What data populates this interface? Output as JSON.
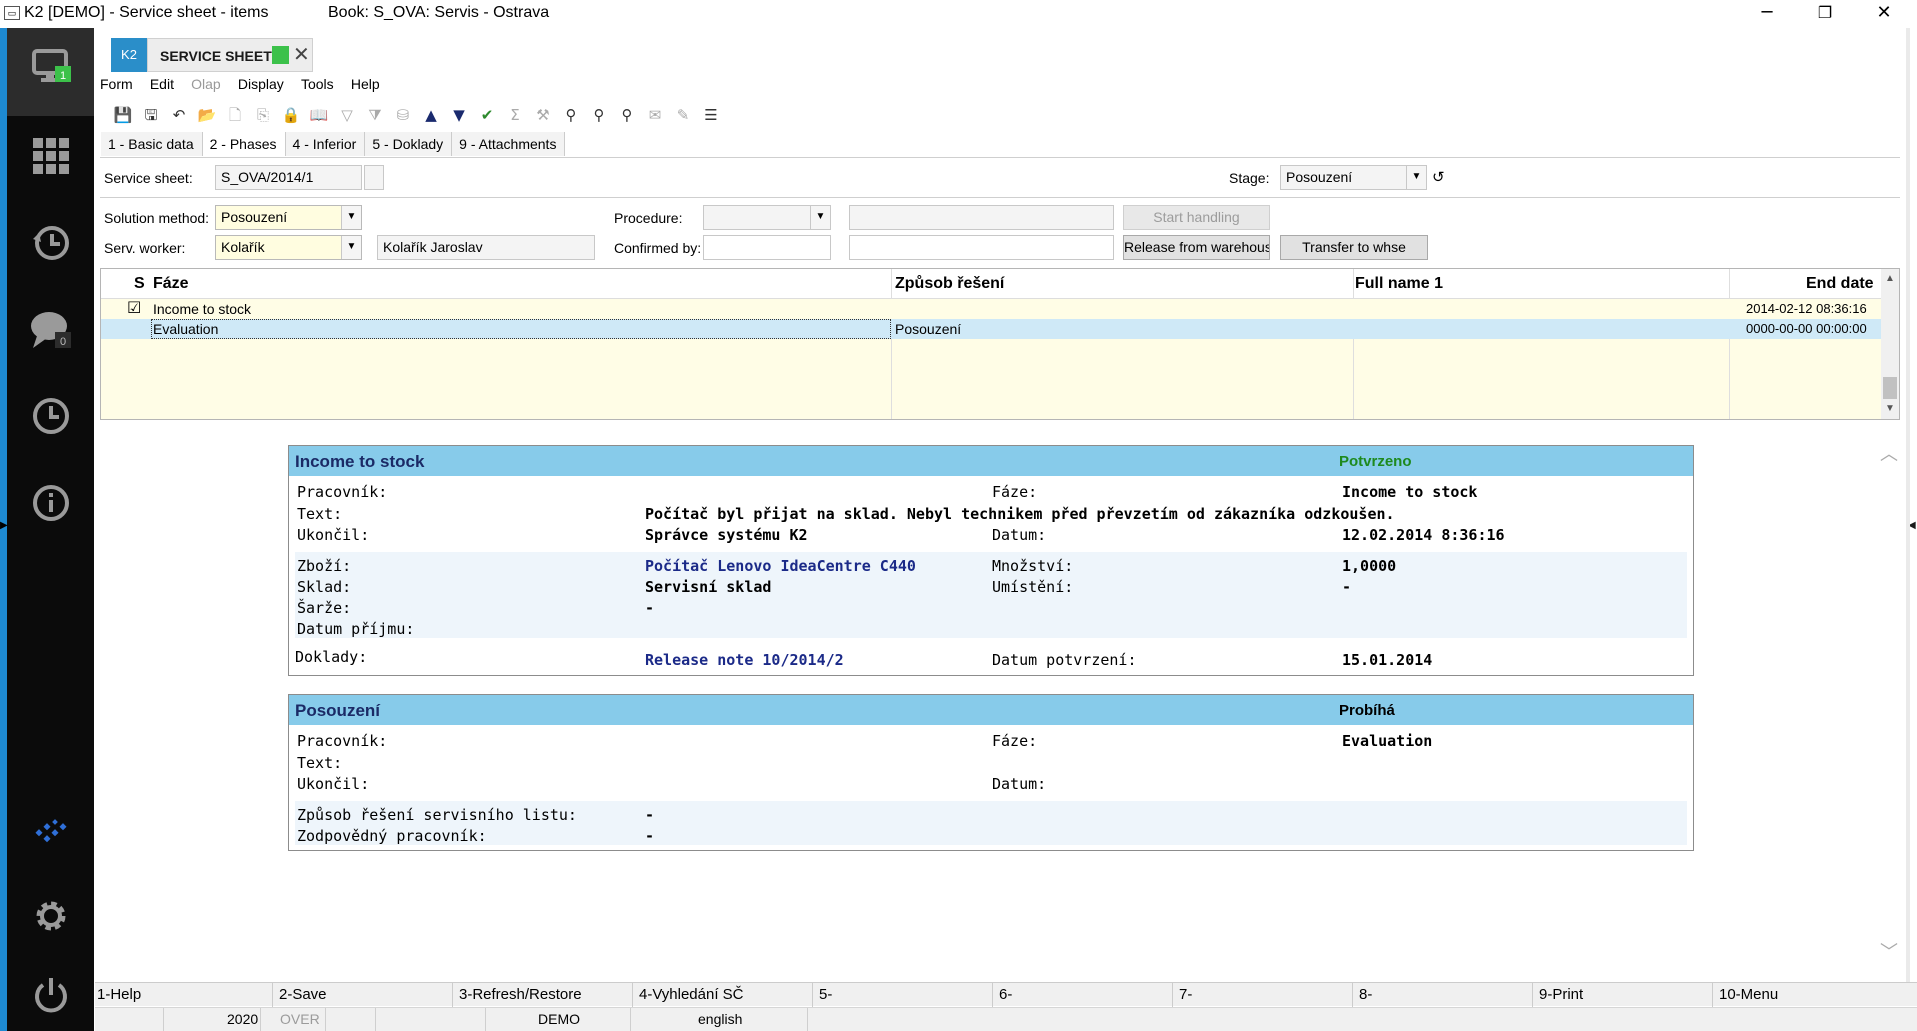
{
  "window": {
    "title": "K2 [DEMO] - Service sheet - items",
    "book": "Book: S_OVA: Servis - Ostrava",
    "minimize": "─",
    "restore": "❐",
    "close": "✕"
  },
  "sidebar": {
    "monitor_badge": "1",
    "chat_badge": "0",
    "icons": [
      "monitor-icon",
      "apps-grid-icon",
      "history-icon",
      "chat-icon",
      "clock-icon",
      "info-icon",
      "logo-icon",
      "settings-icon",
      "power-icon"
    ]
  },
  "tab": {
    "badge": "K2",
    "label": "SERVICE SHEETS",
    "close": "✕",
    "status_color": "#3cc14a"
  },
  "menu": [
    "Form",
    "Edit",
    "Olap",
    "Display",
    "Tools",
    "Help"
  ],
  "page_tabs": [
    "1 - Basic data",
    "2 - Phases",
    "4 - Inferior",
    "5 - Doklady",
    "9 - Attachments"
  ],
  "form": {
    "service_sheet_label": "Service sheet:",
    "service_sheet_value": "S_OVA/2014/1",
    "stage_label": "Stage:",
    "stage_value": "Posouzení",
    "solution_method_label": "Solution method:",
    "solution_method_value": "Posouzení",
    "serv_worker_label": "Serv. worker:",
    "serv_worker_value": "Kolařík",
    "serv_worker_name": "Kolařík Jaroslav",
    "procedure_label": "Procedure:",
    "procedure_value": "",
    "confirmed_by_label": "Confirmed by:",
    "start_handling": "Start handling",
    "release_from_warehouse": "Release from warehouse",
    "transfer_to_whse": "Transfer to whse"
  },
  "grid": {
    "columns": [
      "S",
      "Fáze",
      "Způsob řešení",
      "Full name 1",
      "End date"
    ],
    "rows": [
      {
        "s": "☑",
        "faze": "Income to stock",
        "zpusob": "",
        "fullname": "",
        "end": "2014-02-12 08:36:16"
      },
      {
        "s": "",
        "faze": "Evaluation",
        "zpusob": "Posouzení",
        "fullname": "",
        "end": "0000-00-00 00:00:00"
      }
    ]
  },
  "panel1": {
    "title": "Income to stock",
    "status": "Potvrzeno",
    "status_color": "#1e8a1e",
    "pracovnik_label": "Pracovník:",
    "faze_label": "Fáze:",
    "faze_value": "Income to stock",
    "text_label": "Text:",
    "text_value": "Počítač byl přijat na sklad. Nebyl technikem před převzetím od zákazníka odzkoušen.",
    "ukoncil_label": "Ukončil:",
    "ukoncil_value": "Správce systému K2",
    "datum_label": "Datum:",
    "datum_value": "12.02.2014 8:36:16",
    "zbozi_label": "Zboží:",
    "zbozi_value": "Počítač Lenovo IdeaCentre C440",
    "mnozstvi_label": "Množství:",
    "mnozstvi_value": "1,0000",
    "sklad_label": "Sklad:",
    "sklad_value": "Servisní sklad",
    "umisteni_label": "Umístění:",
    "umisteni_value": "-",
    "sarze_label": "Šarže:",
    "sarze_value": "-",
    "datum_prijmu_label": "Datum příjmu:",
    "doklady_label": "Doklady:",
    "doklady_value": "Release note 10/2014/2",
    "datum_potvrzeni_label": "Datum potvrzení:",
    "datum_potvrzeni_value": "15.01.2014"
  },
  "panel2": {
    "title": "Posouzení",
    "status": "Probíhá",
    "pracovnik_label": "Pracovník:",
    "faze_label": "Fáze:",
    "faze_value": "Evaluation",
    "text_label": "Text:",
    "ukoncil_label": "Ukončil:",
    "datum_label": "Datum:",
    "zpusob_label": "Způsob řešení servisního listu:",
    "zpusob_value": "-",
    "zodpovedny_label": "Zodpovědný pracovník:",
    "zodpovedny_value": "-"
  },
  "fkeys": [
    "1-Help",
    "2-Save",
    "3-Refresh/Restore",
    "4-Vyhledání SČ",
    "5-",
    "6-",
    "7-",
    "8-",
    "9-Print",
    "10-Menu"
  ],
  "status": {
    "year": "2020",
    "over": "OVER",
    "demo": "DEMO",
    "language": "english"
  }
}
